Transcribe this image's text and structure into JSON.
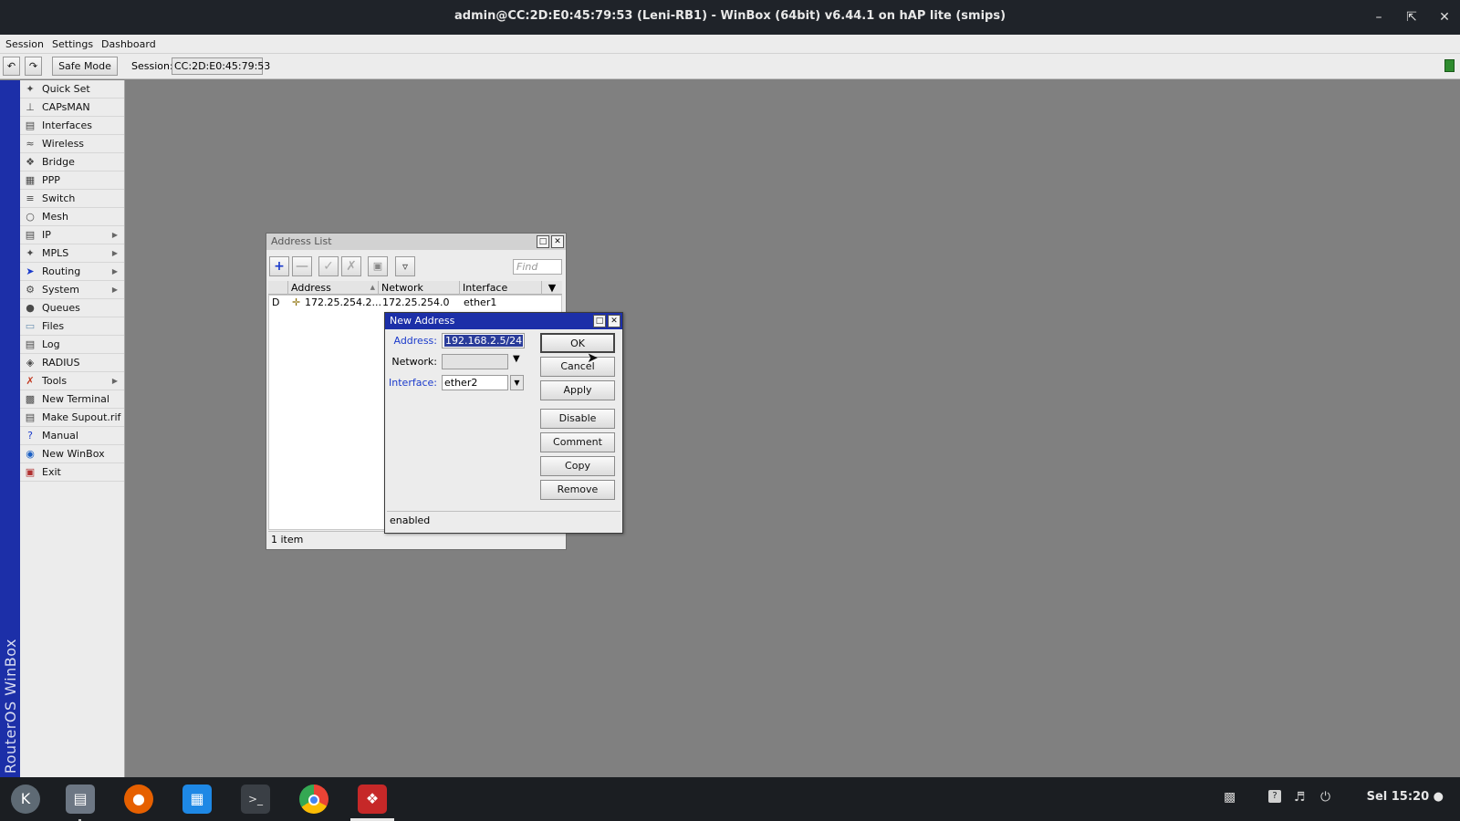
{
  "window": {
    "title": "admin@CC:2D:E0:45:79:53 (Leni-RB1) - WinBox (64bit) v6.44.1 on hAP lite (smips)",
    "controls": [
      "minimize-icon",
      "restore-icon",
      "close-icon"
    ]
  },
  "menubar": {
    "items": [
      "Session",
      "Settings",
      "Dashboard"
    ]
  },
  "toolbar": {
    "undo_icon": "undo-icon",
    "redo_icon": "redo-icon",
    "safe_mode_label": "Safe Mode",
    "session_label": "Session:",
    "session_value": "CC:2D:E0:45:79:53"
  },
  "brand_strip": {
    "text": "RouterOS WinBox",
    "color": "#1c2fa8"
  },
  "sidebar": {
    "items": [
      {
        "label": "Quick Set",
        "icon": "wand-icon",
        "submenu": false
      },
      {
        "label": "CAPsMAN",
        "icon": "antenna-icon",
        "submenu": false
      },
      {
        "label": "Interfaces",
        "icon": "interfaces-icon",
        "submenu": false
      },
      {
        "label": "Wireless",
        "icon": "wireless-icon",
        "submenu": false
      },
      {
        "label": "Bridge",
        "icon": "bridge-icon",
        "submenu": false
      },
      {
        "label": "PPP",
        "icon": "ppp-icon",
        "submenu": false
      },
      {
        "label": "Switch",
        "icon": "switch-icon",
        "submenu": false
      },
      {
        "label": "Mesh",
        "icon": "mesh-icon",
        "submenu": false
      },
      {
        "label": "IP",
        "icon": "ip-icon",
        "submenu": true
      },
      {
        "label": "MPLS",
        "icon": "mpls-icon",
        "submenu": true
      },
      {
        "label": "Routing",
        "icon": "routing-icon",
        "submenu": true
      },
      {
        "label": "System",
        "icon": "gear-icon",
        "submenu": true
      },
      {
        "label": "Queues",
        "icon": "queues-icon",
        "submenu": false
      },
      {
        "label": "Files",
        "icon": "folder-icon",
        "submenu": false
      },
      {
        "label": "Log",
        "icon": "log-icon",
        "submenu": false
      },
      {
        "label": "RADIUS",
        "icon": "radius-icon",
        "submenu": false
      },
      {
        "label": "Tools",
        "icon": "tools-icon",
        "submenu": true
      },
      {
        "label": "New Terminal",
        "icon": "terminal-icon",
        "submenu": false
      },
      {
        "label": "Make Supout.rif",
        "icon": "document-icon",
        "submenu": false
      },
      {
        "label": "Manual",
        "icon": "help-icon",
        "submenu": false
      },
      {
        "label": "New WinBox",
        "icon": "globe-icon",
        "submenu": false
      },
      {
        "label": "Exit",
        "icon": "exit-icon",
        "submenu": false
      }
    ]
  },
  "address_list": {
    "title": "Address List",
    "find_placeholder": "Find",
    "toolbar_icons": [
      "plus-icon",
      "minus-icon",
      "check-icon",
      "cross-icon",
      "comment-icon",
      "filter-icon"
    ],
    "columns": [
      "Address",
      "Network",
      "Interface"
    ],
    "rows": [
      {
        "flag": "D",
        "address": "172.25.254.2...",
        "network": "172.25.254.0",
        "interface": "ether1"
      }
    ],
    "status": "1 item"
  },
  "new_address": {
    "title": "New Address",
    "address_label": "Address:",
    "address_value": "192.168.2.5/24",
    "network_label": "Network:",
    "network_value": "",
    "interface_label": "Interface:",
    "interface_value": "ether2",
    "buttons": [
      "OK",
      "Cancel",
      "Apply",
      "Disable",
      "Comment",
      "Copy",
      "Remove"
    ],
    "status": "enabled"
  },
  "taskbar": {
    "apps": [
      "launcher-icon",
      "files-icon",
      "firefox-icon",
      "store-icon",
      "terminal-icon",
      "chrome-icon",
      "winbox-icon"
    ],
    "tray": [
      "camera-icon",
      "help-icon",
      "volume-icon",
      "power-icon"
    ],
    "clock": "Sel 15:20"
  }
}
